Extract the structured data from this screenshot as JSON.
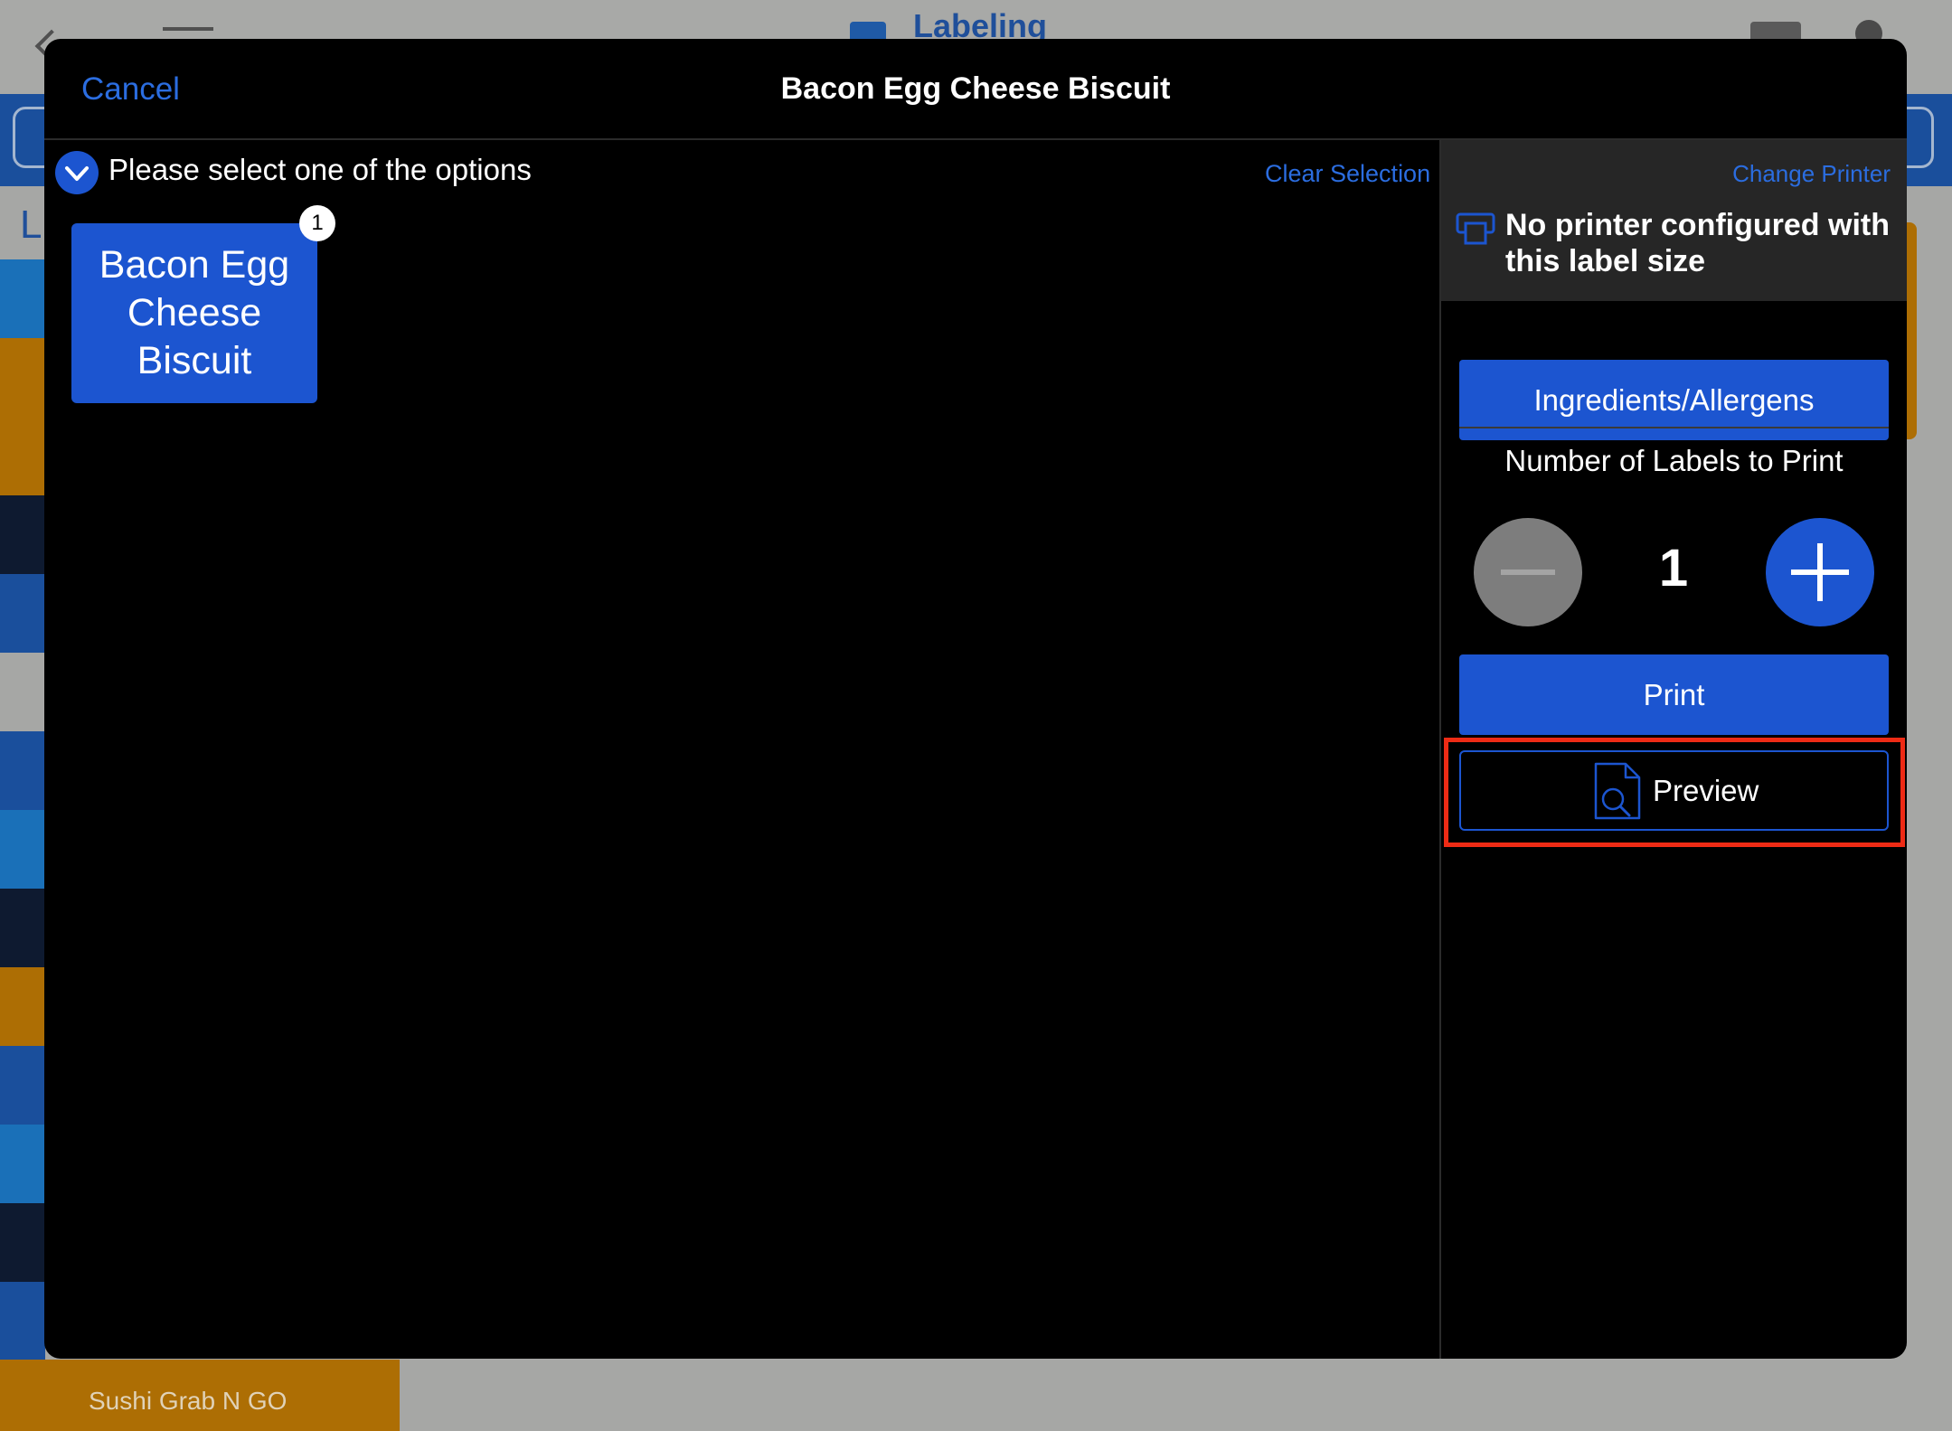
{
  "background": {
    "app_title": "Labeling",
    "side_letter": "L",
    "bottom_tile_label": "Sushi Grab N GO",
    "strip_colors": [
      "#1a70b8",
      "#ad6e04",
      "#ad6e04",
      "#0e1a30",
      "#1a4f9c",
      "#a6a7a5",
      "#1a4f9c",
      "#1a70b8",
      "#0e1a30",
      "#ad6e04",
      "#1a4f9c",
      "#1a70b8",
      "#0e1a30",
      "#1a4f9c"
    ]
  },
  "modal": {
    "cancel_label": "Cancel",
    "title": "Bacon Egg Cheese Biscuit",
    "prompt": "Please select one of the options",
    "clear_selection": "Clear Selection",
    "option": {
      "lines": [
        "Bacon Egg",
        "Cheese",
        "Biscuit"
      ],
      "badge": "1"
    },
    "printer": {
      "change_printer": "Change Printer",
      "message": "No printer configured with this label size"
    },
    "ingredients_button": "Ingredients/Allergens",
    "labels_heading": "Number of Labels to Print",
    "label_count": "1",
    "print_button": "Print",
    "preview_button": "Preview"
  },
  "colors": {
    "accent": "#1c55d0",
    "link": "#2b6de0",
    "highlight": "#ee2b15"
  }
}
